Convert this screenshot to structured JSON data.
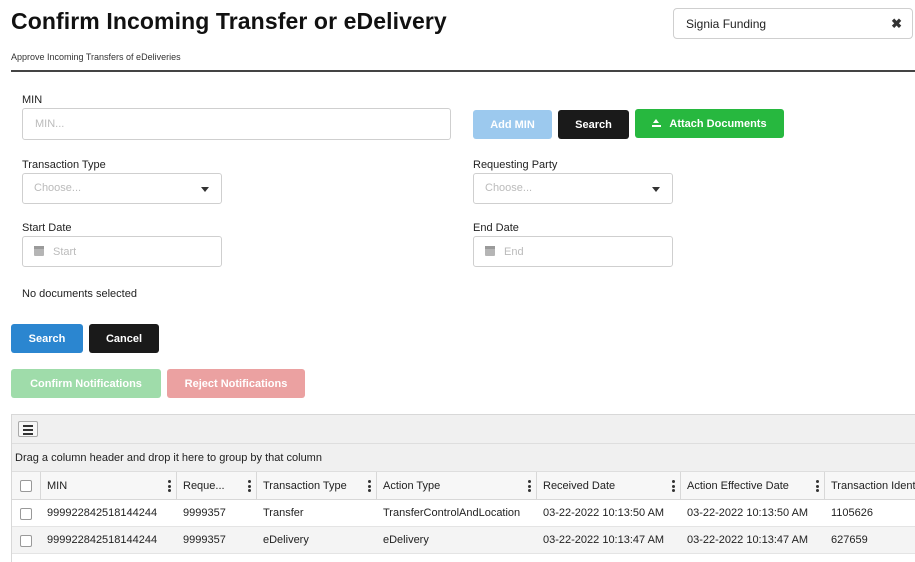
{
  "header": {
    "title": "Confirm Incoming Transfer or eDelivery",
    "subtitle": "Approve Incoming Transfers of eDeliveries",
    "organization": "Signia Funding",
    "clear_symbol": "✖"
  },
  "form": {
    "min_label": "MIN",
    "min_placeholder": "MIN...",
    "add_min_label": "Add MIN",
    "search_top_label": "Search",
    "attach_label": "Attach Documents",
    "transaction_type_label": "Transaction Type",
    "transaction_type_placeholder": "Choose...",
    "requesting_party_label": "Requesting Party",
    "requesting_party_placeholder": "Choose...",
    "start_date_label": "Start Date",
    "start_date_placeholder": "Start",
    "end_date_label": "End Date",
    "end_date_placeholder": "End",
    "no_docs_text": "No documents selected",
    "search_label": "Search",
    "cancel_label": "Cancel",
    "confirm_label": "Confirm Notifications",
    "reject_label": "Reject Notifications"
  },
  "grid": {
    "group_hint": "Drag a column header and drop it here to group by that column",
    "columns": [
      "MIN",
      "Reque...",
      "Transaction Type",
      "Action Type",
      "Received Date",
      "Action Effective Date",
      "Transaction Identi"
    ],
    "rows": [
      [
        "999922842518144244",
        "9999357",
        "Transfer",
        "TransferControlAndLocation",
        "03-22-2022 10:13:50 AM",
        "03-22-2022 10:13:50 AM",
        "1105626"
      ],
      [
        "999922842518144244",
        "9999357",
        "eDelivery",
        "eDelivery",
        "03-22-2022 10:13:47 AM",
        "03-22-2022 10:13:47 AM",
        "627659"
      ]
    ]
  },
  "colors": {
    "add_min": "#9cc9ee",
    "attach": "#27b83f",
    "search": "#2b86d0",
    "confirm": "#9fdcaa",
    "reject": "#eba1a1"
  },
  "icons": {
    "clear": "close-icon",
    "attach": "upload-icon",
    "date": "calendar-icon",
    "dropdown": "caret-down-icon",
    "grid_menu": "hamburger-menu-icon",
    "column_menu": "kebab-menu-icon"
  }
}
